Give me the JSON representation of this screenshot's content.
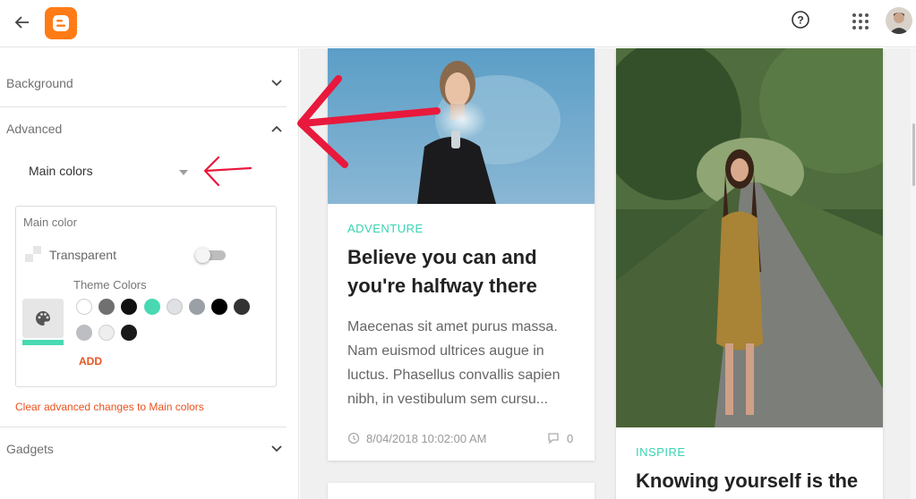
{
  "sidebar": {
    "sections": [
      {
        "label": "Background"
      },
      {
        "label": "Advanced"
      },
      {
        "label": "Gadgets"
      }
    ],
    "dropdown": {
      "selected": "Main colors"
    },
    "main_color": {
      "title": "Main color",
      "transparent_label": "Transparent",
      "transparent_on": false,
      "theme_colors_label": "Theme Colors",
      "current_color": "#48d9b2",
      "swatches": [
        "#ffffff",
        "#707070",
        "#111111",
        "#48d9b2",
        "#dfe1e5",
        "#9aa0a6",
        "#000000",
        "#333333",
        "#bdbec2",
        "#eeeeee",
        "#1a1a1a"
      ],
      "add_label": "ADD"
    },
    "clear_link": "Clear advanced changes to Main colors"
  },
  "preview": {
    "card1": {
      "tag": "ADVENTURE",
      "title_line1": "Believe you can and",
      "title_line2": "you're halfway there",
      "excerpt_lines": [
        "Maecenas sit amet purus massa.",
        "Nam euismod ultrices augue in",
        "luctus. Phasellus convallis sapien",
        "nibh, in vestibulum sem cursu..."
      ],
      "date": "8/04/2018 10:02:00 AM",
      "comments": "0"
    },
    "card2": {
      "tag": "INSPIRE",
      "title": "Knowing yourself is the"
    }
  },
  "colors": {
    "accent": "#48d9b2",
    "link": "#e8531f",
    "logo": "#ff7b15",
    "annotation": "#e8193c"
  }
}
